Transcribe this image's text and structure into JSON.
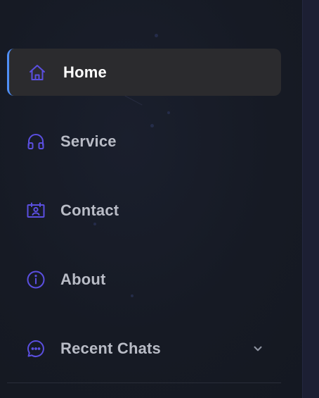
{
  "colors": {
    "accent_icon": "#5b4fe0",
    "active_indicator": "#4f8ff7",
    "active_bg": "#2b2b2e",
    "text_active": "#ffffff",
    "text_inactive": "#b9bcc6",
    "background": "#161a24"
  },
  "sidebar": {
    "items": [
      {
        "label": "Home",
        "icon": "home-icon",
        "active": true
      },
      {
        "label": "Service",
        "icon": "headphones-icon",
        "active": false
      },
      {
        "label": "Contact",
        "icon": "contact-card-icon",
        "active": false
      },
      {
        "label": "About",
        "icon": "info-icon",
        "active": false
      },
      {
        "label": "Recent Chats",
        "icon": "chat-bubble-icon",
        "active": false,
        "expandable": true,
        "expand_icon": "chevron-down-icon"
      }
    ]
  }
}
